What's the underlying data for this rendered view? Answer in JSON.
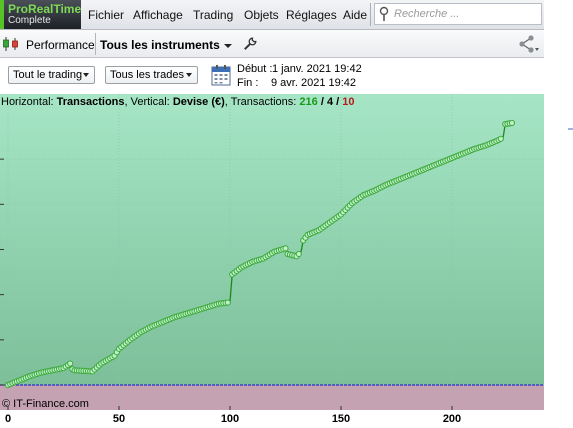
{
  "menubar": {
    "brand": "ProRealTime",
    "edition": "Complete",
    "items": [
      "Fichier",
      "Affichage",
      "Trading",
      "Objets",
      "Réglages",
      "Aide"
    ],
    "search_placeholder": "Recherche ..."
  },
  "toolbar": {
    "view_label": "Performance",
    "instruments_label": "Tous les instruments"
  },
  "options": {
    "scope_label": "Tout le trading",
    "trades_label": "Tous les trades",
    "start_label": "Début :",
    "start_value": "1 janv. 2021 19:42",
    "end_label": "Fin :",
    "end_value": "9 avr. 2021 19:42"
  },
  "status": {
    "h_label": "Horizontal:",
    "h_value": "Transactions",
    "v_label": ", Vertical:",
    "v_value": "Devise (€)",
    "t_label": ", Transactions:",
    "total": "216",
    "sep": "/",
    "neutral": "4",
    "losses": "10"
  },
  "copyright": "© IT-Finance.com",
  "colors": {
    "chart_bg_top": "#a6e6c6",
    "chart_bg_bottom": "#7cbf99",
    "below_zero_bg": "#c5a2b1",
    "line": "#1b8a1b",
    "marker": "#3eaa3e",
    "loss": "#b53a2e",
    "zero_line": "#2c2ccf",
    "win_text": "#1a9a1a",
    "loss_text": "#b21d1d"
  },
  "chart_data": {
    "type": "line",
    "title": "",
    "xlabel": "Transactions",
    "ylabel": "Devise (€)",
    "x_ticks": [
      0,
      50,
      100,
      150,
      200
    ],
    "xlim": [
      0,
      240
    ],
    "ylim": [
      -22,
      250
    ],
    "series": [
      {
        "points": [
          [
            0,
            0
          ],
          [
            5,
            4
          ],
          [
            10,
            8
          ],
          [
            15,
            11
          ],
          [
            20,
            13
          ],
          [
            25,
            15
          ],
          [
            28,
            19
          ],
          [
            29,
            14
          ],
          [
            30,
            13
          ],
          [
            38,
            12
          ],
          [
            42,
            19
          ],
          [
            48,
            26
          ],
          [
            50,
            32
          ],
          [
            55,
            40
          ],
          [
            60,
            47
          ],
          [
            65,
            52
          ],
          [
            70,
            56
          ],
          [
            75,
            60
          ],
          [
            80,
            63
          ],
          [
            85,
            66
          ],
          [
            90,
            69
          ],
          [
            95,
            72
          ],
          [
            99,
            73
          ],
          [
            100,
            74
          ],
          [
            101,
            98
          ],
          [
            105,
            104
          ],
          [
            110,
            109
          ],
          [
            115,
            112
          ],
          [
            120,
            118
          ],
          [
            125,
            121
          ],
          [
            126,
            116
          ],
          [
            130,
            114
          ],
          [
            132,
            118
          ],
          [
            133,
            128
          ],
          [
            135,
            133
          ],
          [
            140,
            137
          ],
          [
            145,
            144
          ],
          [
            150,
            151
          ],
          [
            155,
            161
          ],
          [
            160,
            168
          ],
          [
            165,
            172
          ],
          [
            170,
            177
          ],
          [
            175,
            181
          ],
          [
            180,
            185
          ],
          [
            185,
            189
          ],
          [
            190,
            193
          ],
          [
            195,
            197
          ],
          [
            200,
            201
          ],
          [
            205,
            205
          ],
          [
            210,
            209
          ],
          [
            215,
            212
          ],
          [
            220,
            216
          ],
          [
            223,
            219
          ],
          [
            224,
            231
          ],
          [
            227,
            232
          ]
        ]
      }
    ],
    "grid": true
  }
}
